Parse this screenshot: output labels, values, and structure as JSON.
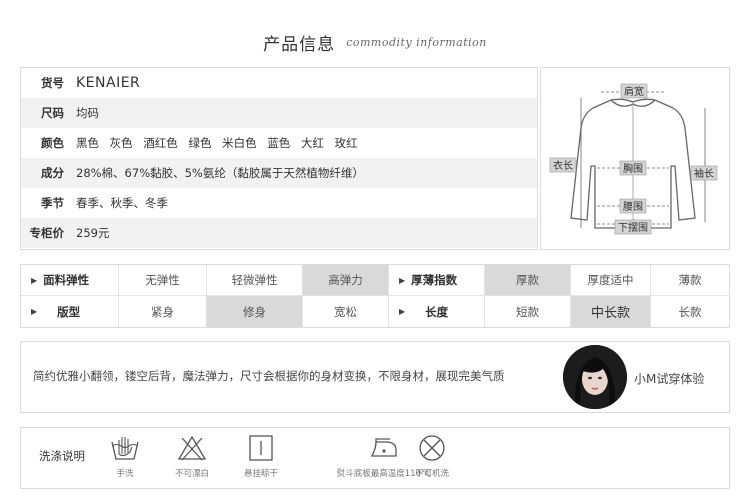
{
  "title": {
    "zh": "产品信息",
    "en": "commodity information"
  },
  "info": {
    "rows": [
      {
        "label": "货号",
        "value": "KENAIER"
      },
      {
        "label": "尺码",
        "value": "均码"
      },
      {
        "label": "颜色",
        "colors": [
          "黑色",
          "灰色",
          "酒红色",
          "绿色",
          "米白色",
          "蓝色",
          "大红",
          "玫红"
        ]
      },
      {
        "label": "成分",
        "value": "28%棉、67%黏胶、5%氨纶（黏胶属于天然植物纤维）"
      },
      {
        "label": "季节",
        "value": "春季、秋季、冬季"
      },
      {
        "label": "专柜价",
        "value": "259元"
      }
    ]
  },
  "diagram": {
    "shoulder": "肩宽",
    "length": "衣长",
    "chest": "胸围",
    "sleeve": "袖长",
    "waist": "腰围",
    "hem": "下摆围"
  },
  "attributes": {
    "row1": {
      "elastic_label": "面料弹性",
      "elastic_options": [
        "无弹性",
        "轻微弹性",
        "高弹力"
      ],
      "thickness_label": "厚薄指数",
      "thickness_options": [
        "厚款",
        "厚度适中",
        "薄款"
      ]
    },
    "row2": {
      "fit_label": "版型",
      "fit_options": [
        "紧身",
        "修身",
        "宽松"
      ],
      "length_label": "长度",
      "length_options": [
        "短款",
        "中长款",
        "长款"
      ]
    },
    "selected": {
      "elastic": "高弹力",
      "thickness": "厚款",
      "fit": "修身",
      "length": "中长款"
    }
  },
  "description": {
    "text": "简约优雅小翻领，镂空后背，魔法弹力，尺寸会根据你的身材变换，不限身材，展现完美气质",
    "model_label": "小M试穿体验"
  },
  "care": {
    "label": "洗涤说明",
    "items": [
      {
        "icon": "hand-wash-icon",
        "caption": "手洗"
      },
      {
        "icon": "no-bleach-icon",
        "caption": "不可漂白"
      },
      {
        "icon": "hang-dry-icon",
        "caption": "悬挂晾干"
      },
      {
        "icon": "iron-icon",
        "caption": "熨斗底板最高温度110°C"
      },
      {
        "icon": "no-machine-wash-icon",
        "caption": "不可机洗"
      }
    ]
  }
}
